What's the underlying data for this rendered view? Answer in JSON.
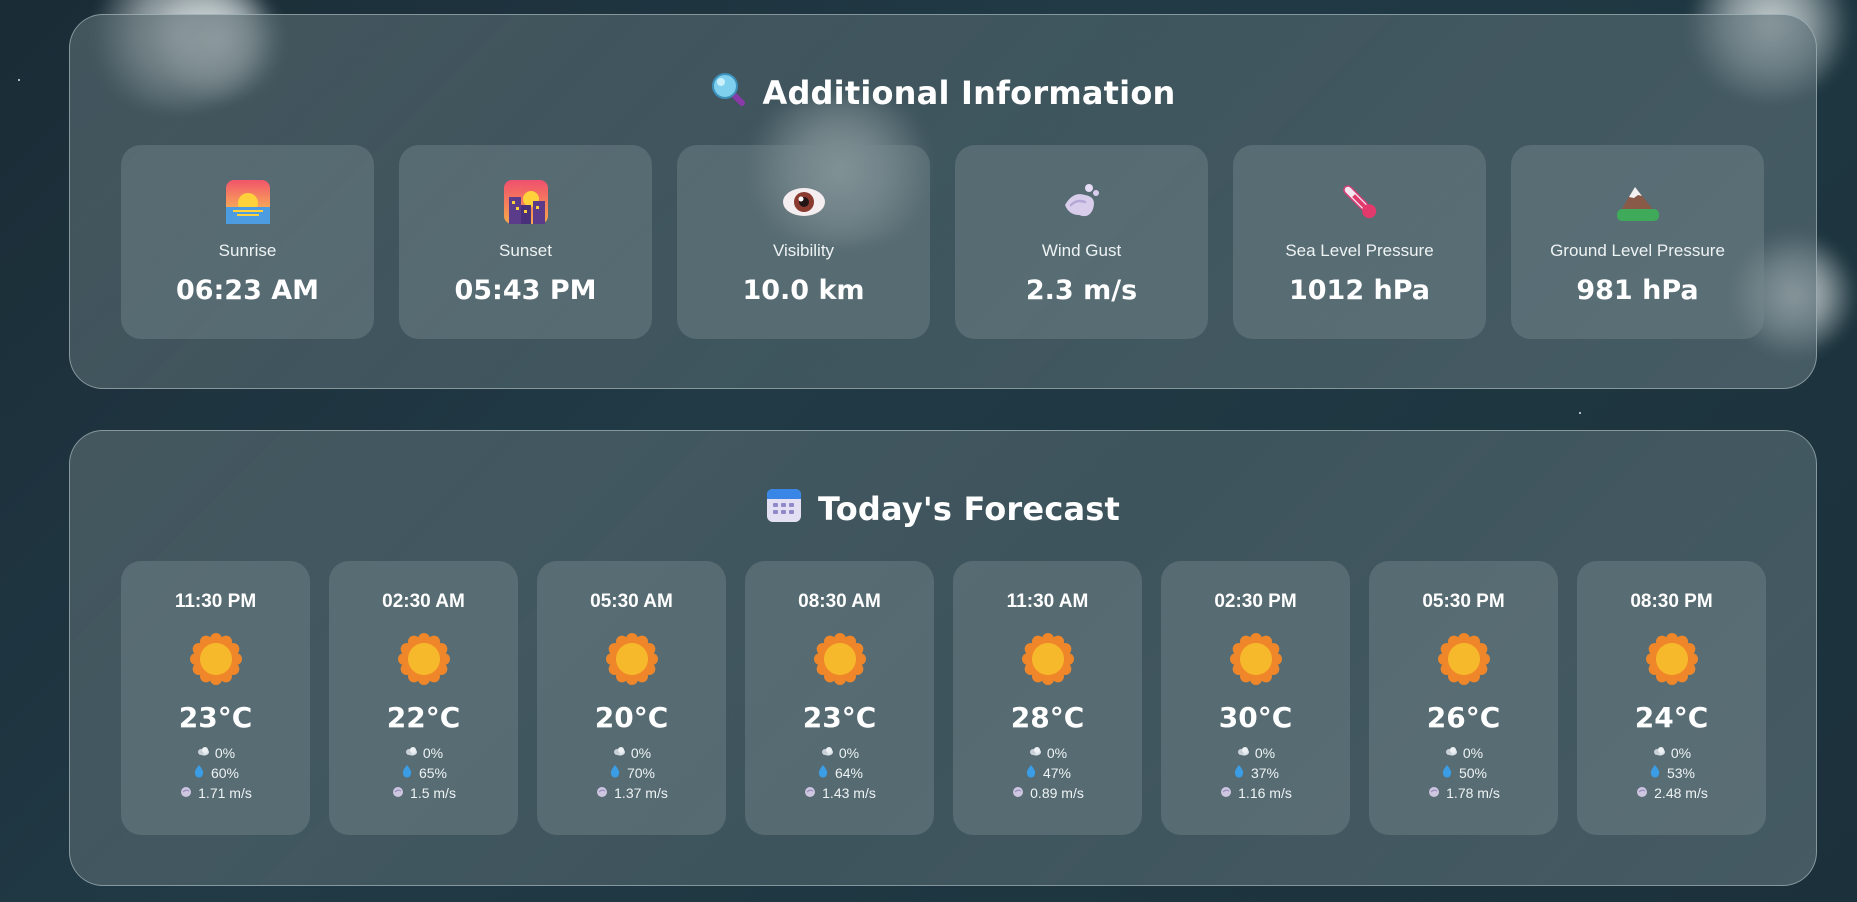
{
  "additional_info": {
    "title": "Additional Information",
    "title_icon": "magnifier-icon",
    "cards": [
      {
        "icon": "sunrise-icon",
        "label": "Sunrise",
        "value": "06:23 AM"
      },
      {
        "icon": "sunset-icon",
        "label": "Sunset",
        "value": "05:43 PM"
      },
      {
        "icon": "eye-icon",
        "label": "Visibility",
        "value": "10.0 km"
      },
      {
        "icon": "wind-icon",
        "label": "Wind Gust",
        "value": "2.3 m/s"
      },
      {
        "icon": "thermometer-icon",
        "label": "Sea Level Pressure",
        "value": "1012 hPa"
      },
      {
        "icon": "mountain-icon",
        "label": "Ground Level Pressure",
        "value": "981 hPa"
      }
    ]
  },
  "forecast": {
    "title": "Today's Forecast",
    "title_icon": "calendar-icon",
    "items": [
      {
        "time": "11:30 PM",
        "icon": "sun-icon",
        "temp": "23°C",
        "cloud": "0%",
        "humidity": "60%",
        "wind": "1.71 m/s"
      },
      {
        "time": "02:30 AM",
        "icon": "sun-icon",
        "temp": "22°C",
        "cloud": "0%",
        "humidity": "65%",
        "wind": "1.5 m/s"
      },
      {
        "time": "05:30 AM",
        "icon": "sun-icon",
        "temp": "20°C",
        "cloud": "0%",
        "humidity": "70%",
        "wind": "1.37 m/s"
      },
      {
        "time": "08:30 AM",
        "icon": "sun-icon",
        "temp": "23°C",
        "cloud": "0%",
        "humidity": "64%",
        "wind": "1.43 m/s"
      },
      {
        "time": "11:30 AM",
        "icon": "sun-icon",
        "temp": "28°C",
        "cloud": "0%",
        "humidity": "47%",
        "wind": "0.89 m/s"
      },
      {
        "time": "02:30 PM",
        "icon": "sun-icon",
        "temp": "30°C",
        "cloud": "0%",
        "humidity": "37%",
        "wind": "1.16 m/s"
      },
      {
        "time": "05:30 PM",
        "icon": "sun-icon",
        "temp": "26°C",
        "cloud": "0%",
        "humidity": "50%",
        "wind": "1.78 m/s"
      },
      {
        "time": "08:30 PM",
        "icon": "sun-icon",
        "temp": "24°C",
        "cloud": "0%",
        "humidity": "53%",
        "wind": "2.48 m/s"
      }
    ]
  },
  "colors": {
    "background": "#1e3640",
    "panel_border": "#bccdd2",
    "sun": "#f5b82e"
  }
}
